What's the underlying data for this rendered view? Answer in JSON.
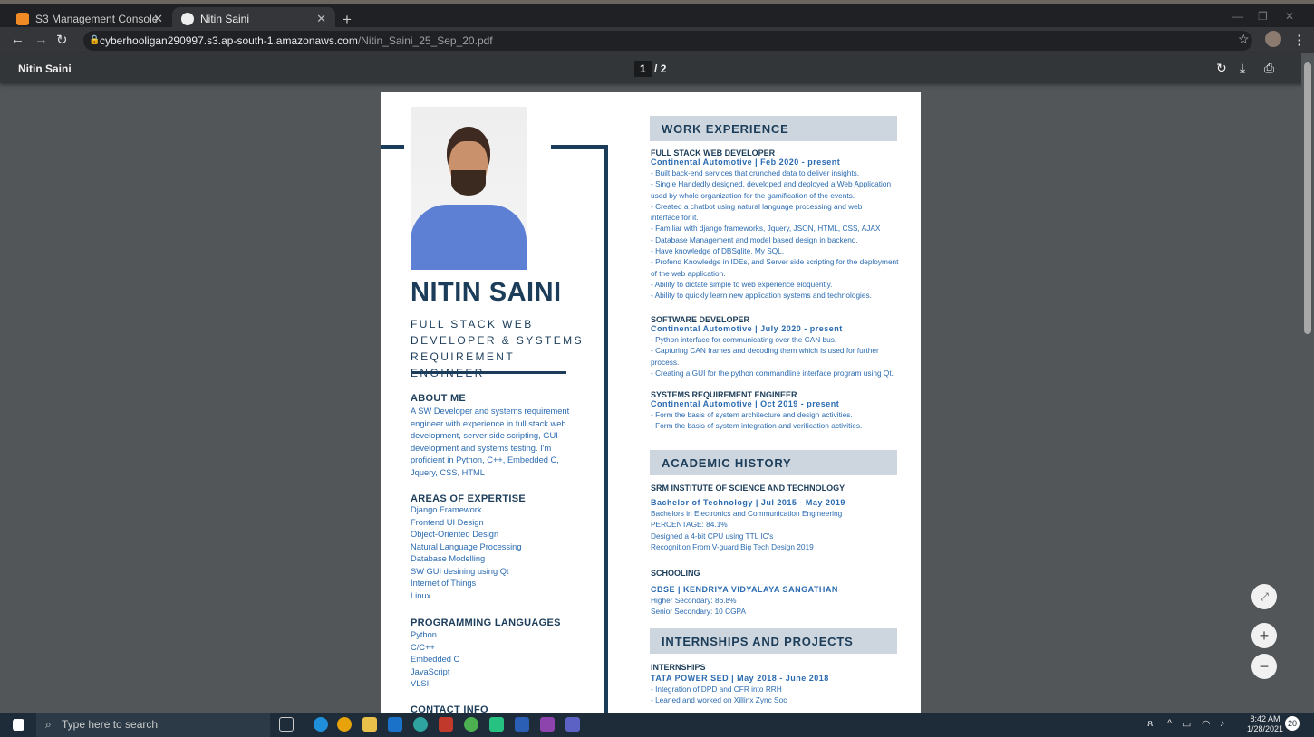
{
  "browser": {
    "tabs": [
      {
        "label": "S3 Management Console",
        "active": false
      },
      {
        "label": "Nitin Saini",
        "active": true
      }
    ],
    "url_host": "cyberhooligan290997.s3.ap-south-1.amazonaws.com",
    "url_path": "/Nitin_Saini_25_Sep_20.pdf"
  },
  "pdf_viewer": {
    "title": "Nitin Saini",
    "current_page": "1",
    "page_total": "/ 2"
  },
  "resume": {
    "name": "NITIN SAINI",
    "subtitle": "FULL STACK WEB DEVELOPER & SYSTEMS REQUIREMENT ENGINEER",
    "about_heading": "ABOUT ME",
    "about_text": " A SW Developer and systems requirement engineer with experience in full stack web development,  server side scripting, GUI development  and systems testing. I'm proficient in Python, C++, Embedded C, Jquery, CSS, HTML .",
    "expertise_heading": "AREAS OF EXPERTISE",
    "expertise": [
      "Django Framework",
      "Frontend UI Design",
      "Object-Oriented Design",
      "Natural Language Processing",
      "Database Modelling",
      "SW GUI desining using Qt",
      "Internet of Things",
      "Linux"
    ],
    "languages_heading": "PROGRAMMING LANGUAGES",
    "languages": [
      "Python",
      "C/C++",
      "Embedded C",
      "JavaScript",
      "VLSI"
    ],
    "contact_heading": "CONTACT INFO",
    "work_heading": "WORK EXPERIENCE",
    "jobs": [
      {
        "title": "FULL STACK WEB DEVELOPER",
        "sub": "Continental Automotive | Feb 2020 - present",
        "lines": [
          "- Built back-end services that crunched data to deliver insights.",
          "- Single Handedly designed, developed and deployed a Web Application",
          "used by whole organization for the gamification of the events.",
          "- Created a chatbot using natural language processing and web",
          "  interface for it.",
          "- Familiar with django frameworks, Jquery, JSON, HTML, CSS, AJAX",
          "- Database Management and model based design in backend.",
          "- Have knowledge of DBSqlite, My SQL.",
          "- Profend Knowledge in IDEs, and Server side scripting for the deployment",
          "of the web application.",
          "- Ability to dictate simple to web experience eloquently.",
          "- Ability to quickly learn new application systems and technologies."
        ]
      },
      {
        "title": "SOFTWARE DEVELOPER",
        "sub": "Continental Automotive | July 2020 - present",
        "lines": [
          "- Python interface for communicating over the CAN bus.",
          "- Capturing CAN frames and decoding them which is used for further",
          "process.",
          "- Creating a GUI for the python commandline interface program using Qt."
        ]
      },
      {
        "title": "SYSTEMS REQUIREMENT ENGINEER",
        "sub": "Continental Automotive | Oct 2019 - present",
        "lines": [
          "- Form the basis of system architecture and design activities.",
          "- Form the basis of system integration and verification activities."
        ]
      }
    ],
    "academic_heading": "ACADEMIC HISTORY",
    "college": "SRM INSTITUTE OF SCIENCE AND TECHNOLOGY",
    "degree": "Bachelor of Technology | Jul 2015 - May 2019",
    "degree_lines": [
      "Bachelors in Electronics and Communication Engineering",
      "PERCENTAGE: 84.1%",
      "Designed a 4-bit CPU using TTL IC's",
      "Recognition From V-guard Big Tech Design 2019"
    ],
    "schooling_heading": "SCHOOLING",
    "school": "CBSE | KENDRIYA VIDYALAYA SANGATHAN",
    "school_lines": [
      "Higher Secondary: 86.8%",
      "Senior Secondary: 10 CGPA"
    ],
    "intern_heading": "INTERNSHIPS AND PROJECTS",
    "intern_sub_heading": "INTERNSHIPS",
    "intern_company": "TATA POWER SED | May 2018 - June 2018",
    "intern_lines": [
      "- Integration of DPD and CFR into RRH",
      "- Leaned and worked on Xillinx Zync Soc"
    ]
  },
  "taskbar": {
    "search_placeholder": "Type here to search",
    "time": "8:42 AM",
    "date": "1/28/2021",
    "notifications": "20"
  }
}
